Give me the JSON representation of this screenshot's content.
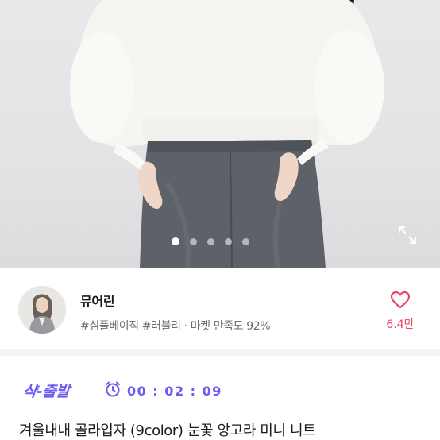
{
  "gallery": {
    "slide_count": 6,
    "active_index": 0,
    "expand_icon": "expand-icon"
  },
  "seller": {
    "name": "뮤어린",
    "tags": "#심플베이직 #러블리 · 마켓 만족도 92%",
    "likes": "6.4만",
    "like_icon": "heart-outline-icon",
    "accent": "#e8456a"
  },
  "promo": {
    "badge": "샥-출발",
    "timer": "00 : 02 : 09",
    "timer_icon": "alarm-clock-icon",
    "accent": "#6a5bf2"
  },
  "product": {
    "title": "겨울내내 골라입자 (9color) 눈꽃 앙고라 미니 니트"
  }
}
